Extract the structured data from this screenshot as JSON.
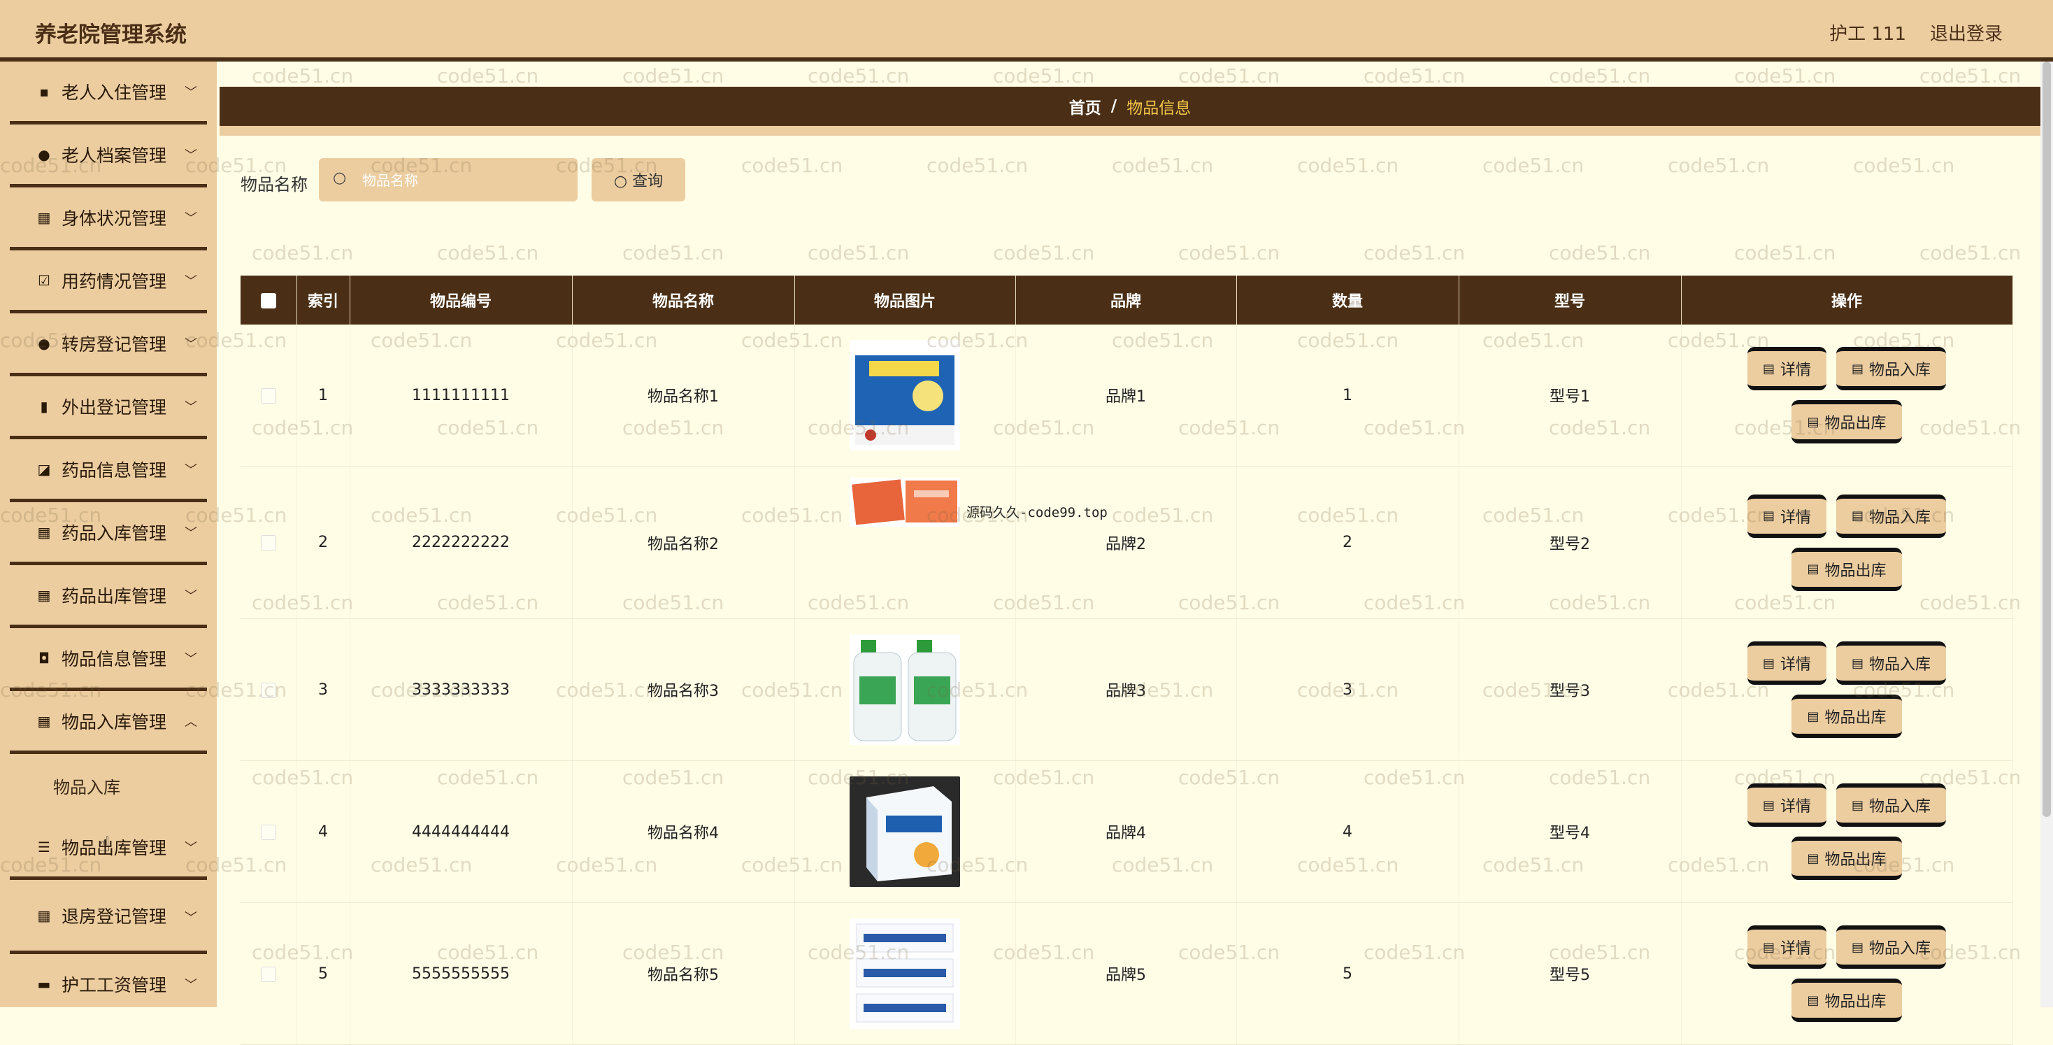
{
  "header": {
    "title": "养老院管理系统",
    "user": "护工 111",
    "logout": "退出登录"
  },
  "sidebar": {
    "items": [
      {
        "label": "老人入住管理",
        "icon": "message-icon"
      },
      {
        "label": "老人档案管理",
        "icon": "user-icon"
      },
      {
        "label": "身体状况管理",
        "icon": "grid-icon"
      },
      {
        "label": "用药情况管理",
        "icon": "checkbox-icon"
      },
      {
        "label": "转房登记管理",
        "icon": "bulb-icon"
      },
      {
        "label": "外出登记管理",
        "icon": "bar-chart-icon"
      },
      {
        "label": "药品信息管理",
        "icon": "trend-icon"
      },
      {
        "label": "药品入库管理",
        "icon": "grid-icon"
      },
      {
        "label": "药品出库管理",
        "icon": "grid-icon"
      },
      {
        "label": "物品信息管理",
        "icon": "briefcase-icon"
      },
      {
        "label": "物品入库管理",
        "icon": "grid-icon"
      },
      {
        "label": "物品出库管理",
        "icon": "list-icon"
      },
      {
        "label": "退房登记管理",
        "icon": "grid-icon"
      },
      {
        "label": "护工工资管理",
        "icon": "ticket-icon"
      }
    ],
    "submenu": {
      "label": "物品入库"
    }
  },
  "breadcrumb": {
    "home": "首页",
    "sep": "/",
    "current": "物品信息"
  },
  "search": {
    "label": "物品名称",
    "placeholder": "物品名称",
    "button": "查询"
  },
  "table": {
    "headers": [
      "索引",
      "物品编号",
      "物品名称",
      "物品图片",
      "品牌",
      "数量",
      "型号",
      "操作"
    ],
    "rows": [
      {
        "index": "1",
        "code": "1111111111",
        "name": "物品名称1",
        "brand": "品牌1",
        "qty": "1",
        "model": "型号1",
        "image": "medicine-box"
      },
      {
        "index": "2",
        "code": "2222222222",
        "name": "物品名称2",
        "brand": "品牌2",
        "qty": "2",
        "model": "型号2",
        "image": "orange-packet"
      },
      {
        "index": "3",
        "code": "3333333333",
        "name": "物品名称3",
        "brand": "品牌3",
        "qty": "3",
        "model": "型号3",
        "image": "detergent-bottles"
      },
      {
        "index": "4",
        "code": "4444444444",
        "name": "物品名称4",
        "brand": "品牌4",
        "qty": "4",
        "model": "型号4",
        "image": "blue-box"
      },
      {
        "index": "5",
        "code": "5555555555",
        "name": "物品名称5",
        "brand": "品牌5",
        "qty": "5",
        "model": "型号5",
        "image": "pill-boxes"
      }
    ],
    "actions": {
      "detail": "详情",
      "stock_in": "物品入库",
      "stock_out": "物品出库"
    }
  },
  "overlay_text": "源码久久-code99.top",
  "watermark": "code51.cn",
  "colors": {
    "header_bg": "#eccda0",
    "dark_brown": "#4a2f16",
    "page_bg": "#fffde6",
    "breadcrumb_active": "#f5c84a"
  }
}
